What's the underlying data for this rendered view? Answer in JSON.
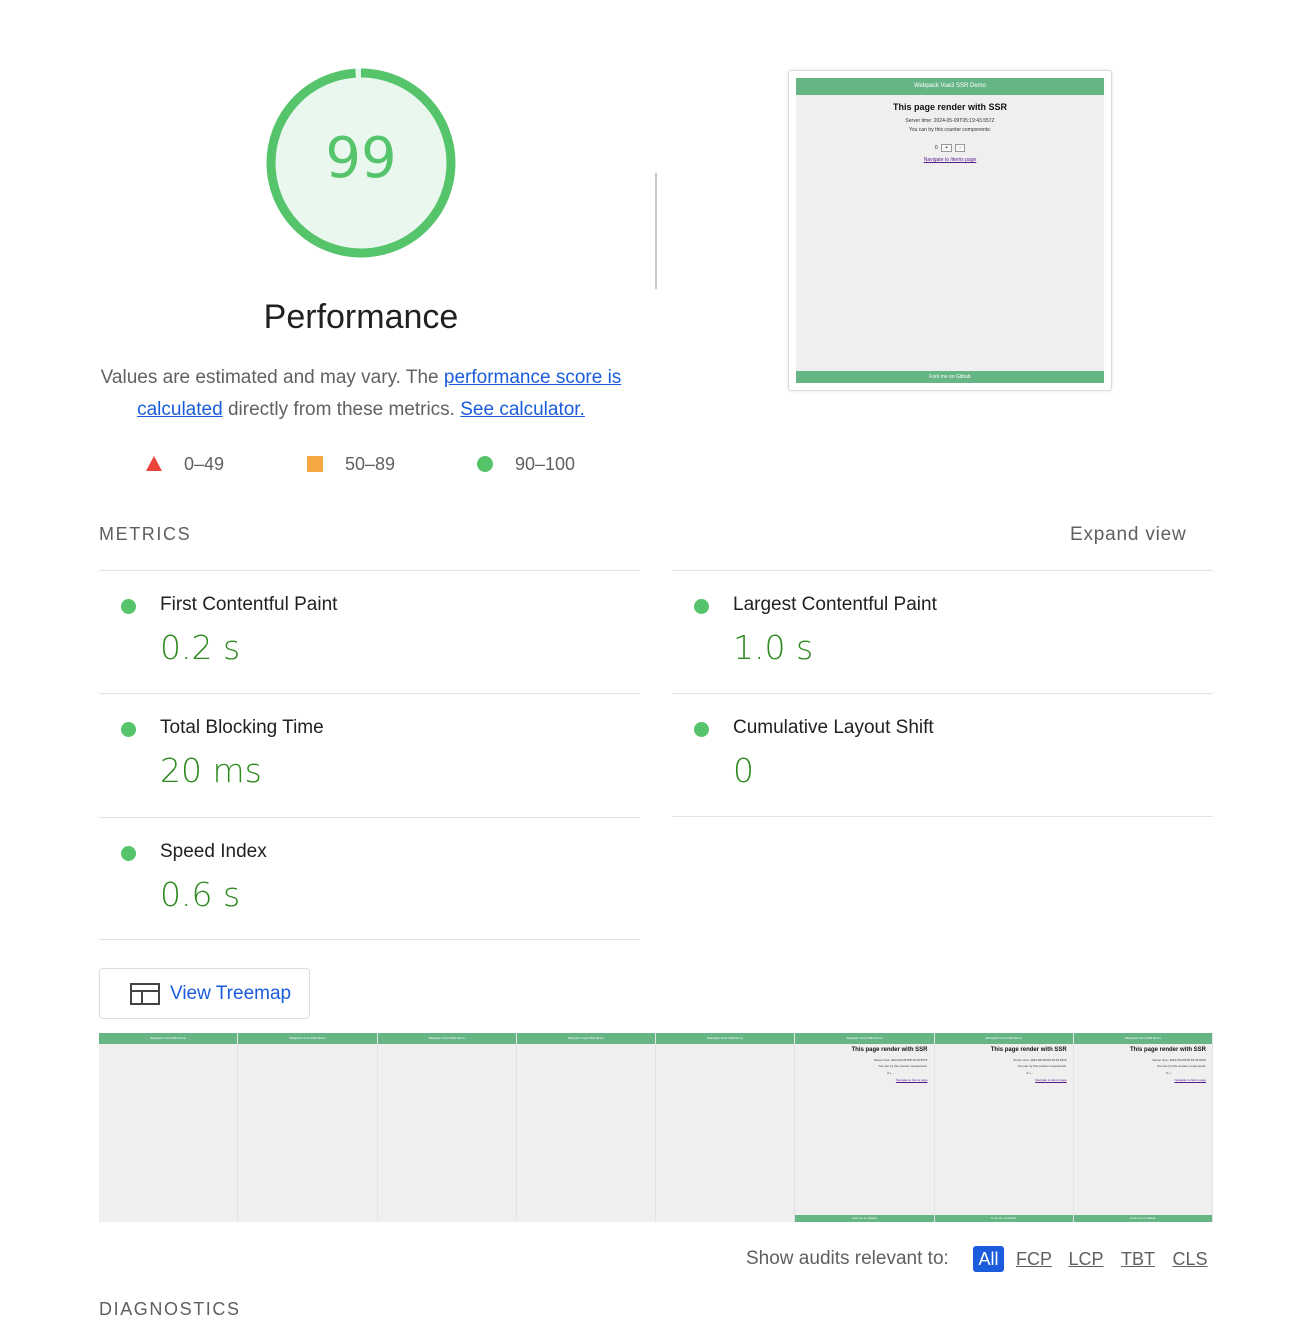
{
  "score": {
    "value": "99",
    "percent": 99,
    "title": "Performance",
    "color": "#56c46b",
    "fill": "#eaf7ee"
  },
  "description": {
    "prefix": "Values are estimated and may vary. The ",
    "link1": "performance score is calculated",
    "middle": " directly from these metrics. ",
    "link2": "See calculator."
  },
  "legend": {
    "items": [
      {
        "range": "0–49",
        "shape": "triangle",
        "color": "#eb4338"
      },
      {
        "range": "50–89",
        "shape": "square",
        "color": "#f4a742"
      },
      {
        "range": "90–100",
        "shape": "circle",
        "color": "#56c46b"
      }
    ]
  },
  "final_screenshot": {
    "header": "Webpack Vue3 SSR Demo",
    "title": "This page render with SSR",
    "server_time": "Server time: 2024-05-09T05:19:43.557Z",
    "counter_hint": "You can try this counter components:",
    "counter_value": "0",
    "plus_label": "+",
    "minus_label": "-",
    "link": "Navigate to /items page",
    "footer": "Fork me on  Github"
  },
  "metrics": {
    "heading": "METRICS",
    "expand_label": "Expand view",
    "items": [
      {
        "name": "First Contentful Paint",
        "value": "0.2 s",
        "status": "good"
      },
      {
        "name": "Largest Contentful Paint",
        "value": "1.0 s",
        "status": "good"
      },
      {
        "name": "Total Blocking Time",
        "value": "20 ms",
        "status": "good"
      },
      {
        "name": "Cumulative Layout Shift",
        "value": "0",
        "status": "good"
      },
      {
        "name": "Speed Index",
        "value": "0.6 s",
        "status": "good"
      }
    ]
  },
  "treemap": {
    "label": "View Treemap",
    "icon": "treemap-icon"
  },
  "filmstrip": {
    "frames": [
      {
        "rendered": false
      },
      {
        "rendered": false
      },
      {
        "rendered": false
      },
      {
        "rendered": false
      },
      {
        "rendered": false
      },
      {
        "rendered": true
      },
      {
        "rendered": true
      },
      {
        "rendered": true
      }
    ],
    "header": "Webpack Vue3 SSR Demo",
    "title": "This page render with SSR",
    "server_time": "Server time: 2024-05-09T05:19:43.557Z",
    "counter_hint": "You can try this counter components:",
    "counter": "0  +  -",
    "link": "Navigate to /items page",
    "footer": "Fork me on Github"
  },
  "filter": {
    "label": "Show audits relevant to:",
    "chips": [
      "All",
      "FCP",
      "LCP",
      "TBT",
      "CLS"
    ],
    "active": "All"
  },
  "diagnostics": {
    "heading": "DIAGNOSTICS"
  }
}
